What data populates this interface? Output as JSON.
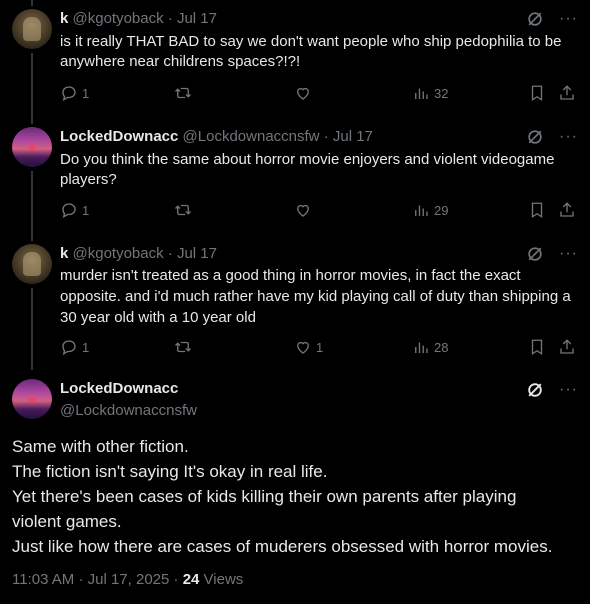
{
  "tweets": [
    {
      "name": "k",
      "handle": "@kgotyoback",
      "sep": "·",
      "date": "Jul 17",
      "text": "is it really THAT BAD to say we don't want people who ship pedophilia to be anywhere near childrens spaces?!?!",
      "replies": "1",
      "retweets": "",
      "likes": "",
      "views": "32"
    },
    {
      "name": "LockedDownacc",
      "handle": "@Lockdownaccnsfw",
      "sep": "·",
      "date": "Jul 17",
      "text": "Do you think the same about horror movie enjoyers and violent videogame players?",
      "replies": "1",
      "retweets": "",
      "likes": "",
      "views": "29"
    },
    {
      "name": "k",
      "handle": "@kgotyoback",
      "sep": "·",
      "date": "Jul 17",
      "text": "murder isn't treated as a good thing in horror movies, in fact the exact opposite. and i'd much rather have my kid playing call of duty than shipping a 30 year old with a 10 year old",
      "replies": "1",
      "retweets": "",
      "likes": "1",
      "views": "28"
    }
  ],
  "main": {
    "name": "LockedDownacc",
    "handle": "@Lockdownaccnsfw",
    "lines": [
      "Same with other fiction.",
      "The fiction isn't saying It's okay in real life.",
      "Yet there's been cases of kids killing their own parents after playing",
      "violent games.",
      "Just like how there are cases of muderers obsessed with horror movies."
    ],
    "time": "11:03 AM",
    "sep": "·",
    "date": "Jul 17, 2025",
    "sep2": "·",
    "views_count": "24",
    "views_label": "Views"
  },
  "colors": {
    "background": "#000000",
    "text": "#e7e9ea",
    "secondary": "#71767b"
  },
  "icons": [
    "reply-icon",
    "retweet-icon",
    "like-icon",
    "views-icon",
    "bookmark-icon",
    "share-icon",
    "grok-icon",
    "more-icon"
  ]
}
